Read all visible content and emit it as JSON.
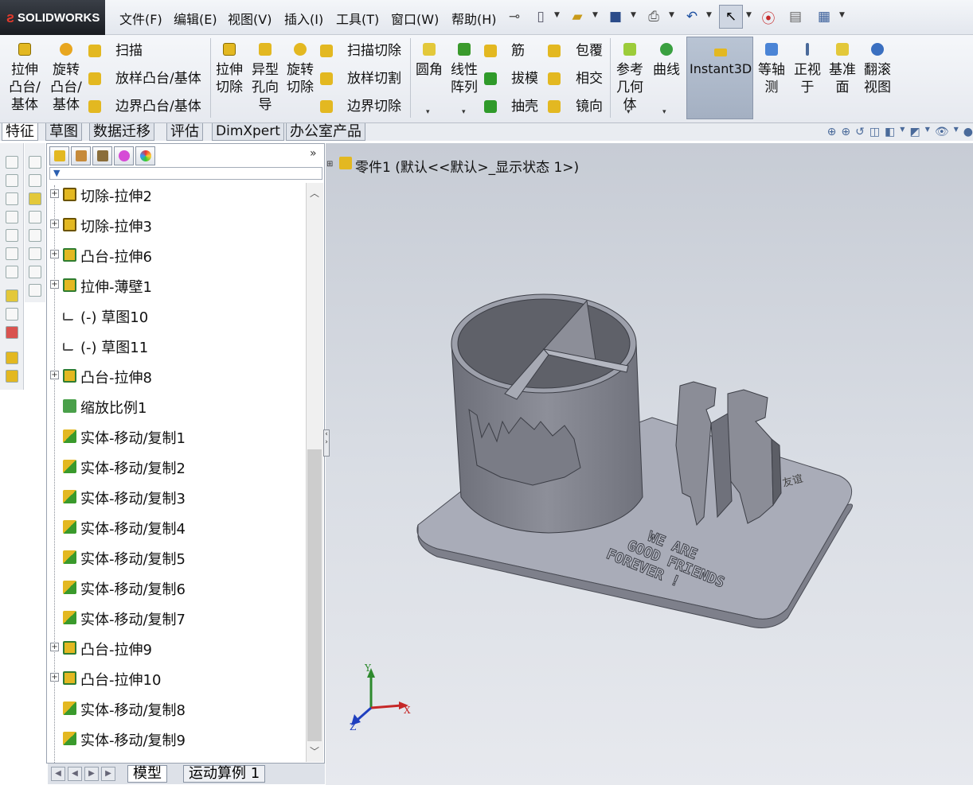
{
  "app": {
    "logo": "SOLIDWORKS",
    "logo_prefix": "3S"
  },
  "menu": [
    "文件(F)",
    "编辑(E)",
    "视图(V)",
    "插入(I)",
    "工具(T)",
    "窗口(W)",
    "帮助(H)"
  ],
  "toolbar": {
    "features": {
      "extrude_boss": "拉伸凸台/基体",
      "revolve_boss": "旋转凸台/基体",
      "sweep": "扫描",
      "loft_boss": "放样凸台/基体",
      "boundary_boss": "边界凸台/基体",
      "extrude_cut": "拉伸切除",
      "hole_wizard": "异型孔向导",
      "revolve_cut": "旋转切除",
      "swept_cut": "扫描切除",
      "lofted_cut": "放样切割",
      "boundary_cut": "边界切除",
      "fillet": "圆角",
      "linear_pattern": "线性阵列",
      "rib": "筋",
      "draft": "拔模",
      "shell": "抽壳",
      "wrap": "包覆",
      "intersect": "相交",
      "mirror": "镜向",
      "ref_geometry": "参考几何体",
      "curves": "曲线",
      "instant3d": "Instant3D",
      "isometric": "等轴测",
      "normal_to": "正视于",
      "datum_plane": "基准面",
      "roll_view": "翻滚视图"
    }
  },
  "tabs": [
    "特征",
    "草图",
    "数据迁移",
    "评估",
    "DimXpert",
    "办公室产品"
  ],
  "tree": {
    "items": [
      {
        "label": "切除-拉伸2",
        "type": "cut",
        "expandable": true
      },
      {
        "label": "切除-拉伸3",
        "type": "cut",
        "expandable": true
      },
      {
        "label": "凸台-拉伸6",
        "type": "boss",
        "expandable": true
      },
      {
        "label": "拉伸-薄壁1",
        "type": "boss",
        "expandable": true
      },
      {
        "label": "(-) 草图10",
        "type": "sketch",
        "expandable": false
      },
      {
        "label": "(-) 草图11",
        "type": "sketch",
        "expandable": false
      },
      {
        "label": "凸台-拉伸8",
        "type": "boss",
        "expandable": true
      },
      {
        "label": "缩放比例1",
        "type": "scale",
        "expandable": false
      },
      {
        "label": "实体-移动/复制1",
        "type": "move",
        "expandable": false
      },
      {
        "label": "实体-移动/复制2",
        "type": "move",
        "expandable": false
      },
      {
        "label": "实体-移动/复制3",
        "type": "move",
        "expandable": false
      },
      {
        "label": "实体-移动/复制4",
        "type": "move",
        "expandable": false
      },
      {
        "label": "实体-移动/复制5",
        "type": "move",
        "expandable": false
      },
      {
        "label": "实体-移动/复制6",
        "type": "move",
        "expandable": false
      },
      {
        "label": "实体-移动/复制7",
        "type": "move",
        "expandable": false
      },
      {
        "label": "凸台-拉伸9",
        "type": "boss",
        "expandable": true
      },
      {
        "label": "凸台-拉伸10",
        "type": "boss",
        "expandable": true
      },
      {
        "label": "实体-移动/复制8",
        "type": "move",
        "expandable": false
      },
      {
        "label": "实体-移动/复制9",
        "type": "move",
        "expandable": false
      }
    ]
  },
  "bottom_tabs": [
    "模型",
    "运动算例 1"
  ],
  "viewport": {
    "part_title": "零件1  (默认<<默认>_显示状态 1>)",
    "engraving": [
      "WE ARE",
      "GOOD FRIENDS",
      "FOREVER !"
    ],
    "triad": {
      "x": "X",
      "y": "Y",
      "z": "Z"
    }
  },
  "colors": {
    "part": "#8d8f99",
    "base": "#a9acb8",
    "viewport_top": "#c7ccd5"
  }
}
